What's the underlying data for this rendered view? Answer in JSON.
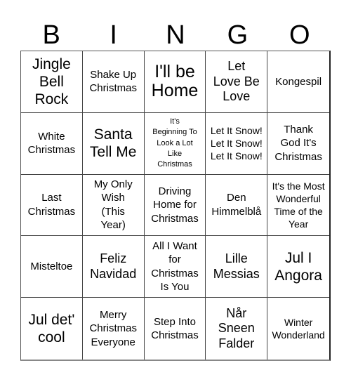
{
  "header": {
    "letters": [
      "B",
      "I",
      "N",
      "G",
      "O"
    ]
  },
  "cells": [
    {
      "text": "Jingle\nBell\nRock",
      "size": "s-lg"
    },
    {
      "text": "Shake Up\nChristmas",
      "size": "s-sm"
    },
    {
      "text": "I'll be\nHome",
      "size": "s-xl"
    },
    {
      "text": "Let\nLove Be\nLove",
      "size": "s-md"
    },
    {
      "text": "Kongespil",
      "size": "s-sm"
    },
    {
      "text": "White\nChristmas",
      "size": "s-sm"
    },
    {
      "text": "Santa\nTell Me",
      "size": "s-lg"
    },
    {
      "text": "It's\nBeginning To\nLook a Lot\nLike\nChristmas",
      "size": "s-tiny"
    },
    {
      "text": "Let It Snow!\nLet It Snow!\nLet It Snow!",
      "size": "s-xs"
    },
    {
      "text": "Thank\nGod It's\nChristmas",
      "size": "s-sm"
    },
    {
      "text": "Last\nChristmas",
      "size": "s-sm"
    },
    {
      "text": "My Only\nWish\n(This\nYear)",
      "size": "s-sm"
    },
    {
      "text": "Driving\nHome for\nChristmas",
      "size": "s-sm"
    },
    {
      "text": "Den\nHimmelblå",
      "size": "s-sm"
    },
    {
      "text": "It's the Most\nWonderful\nTime of the\nYear",
      "size": "s-xs"
    },
    {
      "text": "Misteltoe",
      "size": "s-sm"
    },
    {
      "text": "Feliz\nNavidad",
      "size": "s-md"
    },
    {
      "text": "All I Want\nfor\nChristmas\nIs You",
      "size": "s-sm"
    },
    {
      "text": "Lille\nMessias",
      "size": "s-md"
    },
    {
      "text": "Jul I\nAngora",
      "size": "s-lg"
    },
    {
      "text": "Jul det'\ncool",
      "size": "s-lg"
    },
    {
      "text": "Merry\nChristmas\nEveryone",
      "size": "s-sm"
    },
    {
      "text": "Step Into\nChristmas",
      "size": "s-sm"
    },
    {
      "text": "Når\nSneen\nFalder",
      "size": "s-md"
    },
    {
      "text": "Winter\nWonderland",
      "size": "s-xs"
    }
  ]
}
